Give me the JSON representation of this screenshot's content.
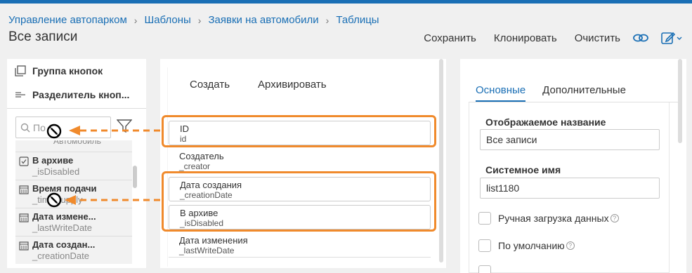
{
  "breadcrumb": [
    {
      "label": "Управление автопарком"
    },
    {
      "label": "Шаблоны"
    },
    {
      "label": "Заявки на автомобили"
    },
    {
      "label": "Таблицы"
    }
  ],
  "page_title": "Все записи",
  "toolbar": {
    "save_label": "Сохранить",
    "clone_label": "Клонировать",
    "clear_label": "Очистить"
  },
  "left_panel": {
    "button_group_label": "Группа кнопок",
    "button_separator_label": "Разделитель кноп...",
    "search_placeholder": "По",
    "partial_top_text": "Автомобиль",
    "fields": [
      {
        "name": "В архиве",
        "system": "_isDisabled",
        "icon": "checkbox-icon"
      },
      {
        "name": "Время подачи",
        "system": "_timeSupply",
        "icon": "calendar-icon"
      },
      {
        "name": "Дата измене...",
        "system": "_lastWriteDate",
        "icon": "calendar-icon"
      },
      {
        "name": "Дата создан...",
        "system": "_creationDate",
        "icon": "calendar-icon"
      }
    ]
  },
  "middle_panel": {
    "buttons": [
      "Создать",
      "Архивировать"
    ],
    "columns": [
      {
        "title": "ID",
        "system": "id"
      },
      {
        "title": "Создатель",
        "system": "_creator"
      },
      {
        "title": "Дата создания",
        "system": "_creationDate"
      },
      {
        "title": "В архиве",
        "system": "_isDisabled"
      },
      {
        "title": "Дата изменения",
        "system": "_lastWriteDate"
      }
    ]
  },
  "right_panel": {
    "tabs": [
      {
        "label": "Основные",
        "active": true
      },
      {
        "label": "Дополнительные",
        "active": false
      }
    ],
    "display_name_label": "Отображаемое название",
    "display_name_value": "Все записи",
    "system_name_label": "Системное имя",
    "system_name_value": "list1180",
    "manual_load_label": "Ручная загрузка данных",
    "default_label": "По умолчанию"
  },
  "colors": {
    "accent": "#1a6fb5",
    "highlight": "#f08a2c"
  }
}
